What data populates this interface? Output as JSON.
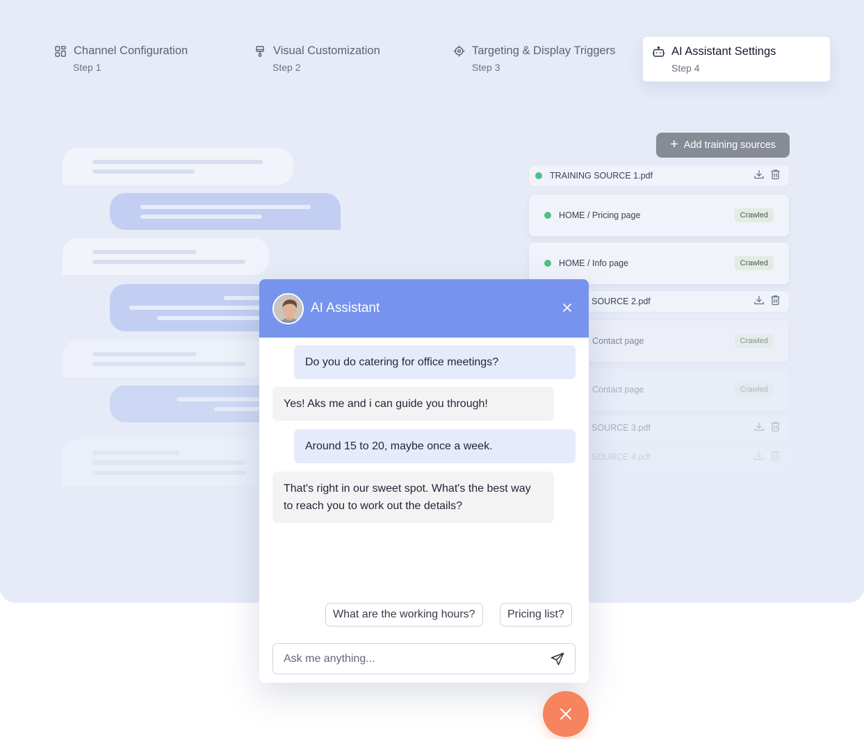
{
  "steps": [
    {
      "title": "Channel Configuration",
      "sub": "Step 1",
      "icon": "grid-icon"
    },
    {
      "title": "Visual Customization",
      "sub": "Step 2",
      "icon": "brush-icon"
    },
    {
      "title": "Targeting & Display Triggers",
      "sub": "Step 3",
      "icon": "target-icon"
    },
    {
      "title": "AI Assistant Settings",
      "sub": "Step 4",
      "icon": "robot-icon",
      "active": true
    }
  ],
  "training": {
    "add_label": "Add training sources",
    "sources": [
      {
        "name": "TRAINING SOURCE 1.pdf",
        "type": "file"
      },
      {
        "name": "HOME / Pricing page",
        "type": "page",
        "badge": "Crawled"
      },
      {
        "name": "HOME / Info page",
        "type": "page",
        "badge": "Crawled"
      },
      {
        "name": "SOURCE 2.pdf",
        "type": "file"
      },
      {
        "name": "Contact page",
        "type": "page",
        "badge": "Crawled"
      },
      {
        "name": "Contact page",
        "type": "page",
        "badge": "Crawled"
      },
      {
        "name": "SOURCE 3.pdf",
        "type": "file"
      },
      {
        "name": "SOURCE 4.pdf",
        "type": "file"
      }
    ]
  },
  "chat": {
    "title": "AI Assistant",
    "messages": [
      {
        "from": "user",
        "text": "Do you do catering for office meetings?"
      },
      {
        "from": "bot",
        "text": "Yes! Aks me and i can guide you through!"
      },
      {
        "from": "user",
        "text": "Around 15 to 20, maybe once a week."
      },
      {
        "from": "bot",
        "text": "That's right in our sweet spot. What's the best way to reach you to work out the details?"
      }
    ],
    "suggestions": [
      "What are the working hours?",
      "Pricing list?"
    ],
    "input_placeholder": "Ask me anything..."
  },
  "colors": {
    "panel_bg": "#e6ebf7",
    "chat_header": "#7693ed",
    "fab": "#f6845f",
    "status_dot": "#4cc08a"
  }
}
